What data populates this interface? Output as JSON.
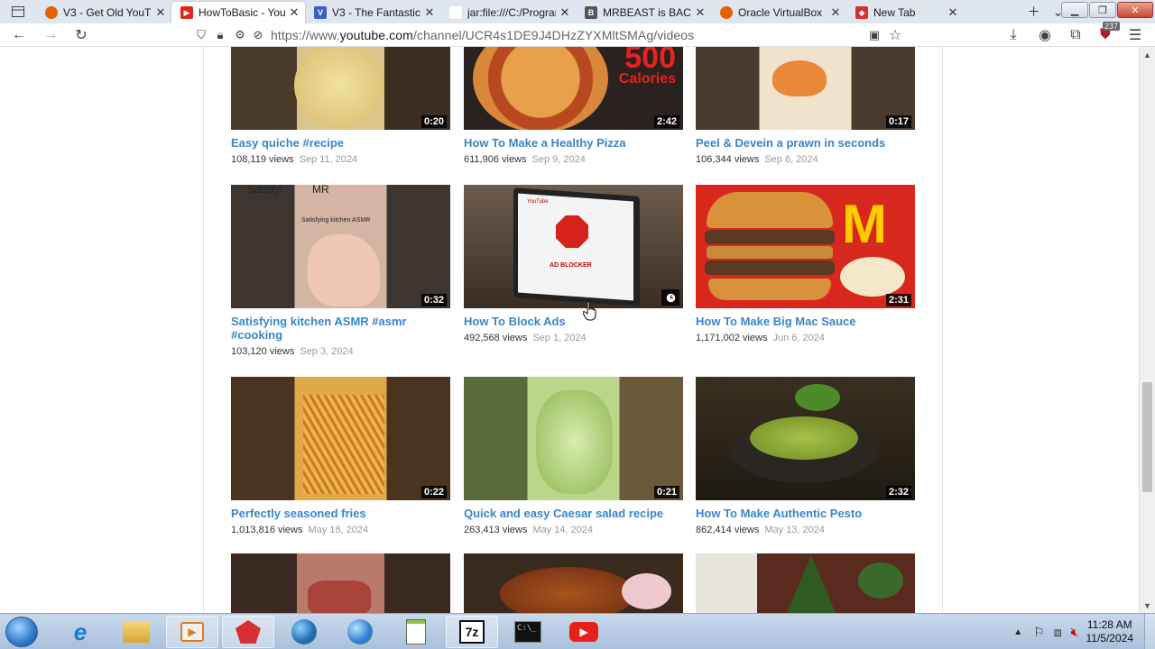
{
  "browser": {
    "tabs": [
      {
        "title": "V3 - Get Old YouT",
        "fav_color": "#e66000",
        "active": false
      },
      {
        "title": "HowToBasic - You",
        "fav_color": "#e62117",
        "active": true
      },
      {
        "title": "V3 - The Fantastic",
        "fav_color": "#3b5fc4",
        "active": false
      },
      {
        "title": "jar:file:///C:/Program",
        "fav_color": "#ffffff",
        "active": false
      },
      {
        "title": "MRBEAST is BACK",
        "fav_color": "#555555",
        "active": false
      },
      {
        "title": "Oracle VirtualBox",
        "fav_color": "#e66000",
        "active": false
      },
      {
        "title": "New Tab",
        "fav_color": "#d63031",
        "active": false
      }
    ],
    "tab_count": "7",
    "url_prefix": "https://www.",
    "url_domain": "youtube.com",
    "url_path": "/channel/UCR4s1DE9J4DHzZYXMltSMAg/videos",
    "ext_badge": "237"
  },
  "videos": [
    {
      "title": "Easy quiche #recipe",
      "views": "108,119 views",
      "date": "Sep 11, 2024",
      "duration": "0:20",
      "thumb": "#b8a47a"
    },
    {
      "title": "How To Make a Healthy Pizza",
      "views": "611,906 views",
      "date": "Sep 9, 2024",
      "duration": "2:42",
      "thumb": "#3a2a22"
    },
    {
      "title": "Peel & Devein a prawn in seconds",
      "views": "106,344 views",
      "date": "Sep 6, 2024",
      "duration": "0:17",
      "thumb": "#e9d2b6"
    },
    {
      "title": "Satisfying kitchen ASMR #asmr #cooking",
      "views": "103,120 views",
      "date": "Sep 3, 2024",
      "duration": "0:32",
      "thumb": "#c9a898"
    },
    {
      "title": "How To Block Ads",
      "views": "492,568 views",
      "date": "Sep 1, 2024",
      "duration": "",
      "thumb": "#6b5a4c"
    },
    {
      "title": "How To Make Big Mac Sauce",
      "views": "1,171,002 views",
      "date": "Jun 6, 2024",
      "duration": "2:31",
      "thumb": "#d8281e"
    },
    {
      "title": "Perfectly seasoned fries",
      "views": "1,013,816 views",
      "date": "May 18, 2024",
      "duration": "0:22",
      "thumb": "#d99b3a"
    },
    {
      "title": "Quick and easy Caesar salad recipe",
      "views": "263,413 views",
      "date": "May 14, 2024",
      "duration": "0:21",
      "thumb": "#9fbf6a"
    },
    {
      "title": "How To Make Authentic Pesto",
      "views": "862,414 views",
      "date": "May 13, 2024",
      "duration": "2:32",
      "thumb": "#5a6b3a"
    },
    {
      "title": "",
      "views": "",
      "date": "",
      "duration": "",
      "thumb": "#8c5a4a"
    },
    {
      "title": "",
      "views": "",
      "date": "",
      "duration": "",
      "thumb": "#7a3a22"
    },
    {
      "title": "",
      "views": "",
      "date": "",
      "duration": "",
      "thumb": "#6a2a22"
    }
  ],
  "thumb_texts": {
    "pizza": "500",
    "pizza_sub": "Calories",
    "asmr": "Satisfying kitchen ASMR",
    "asmr_top": "Satisfyi          MR",
    "adblock": "AD BLOCKER",
    "adblock_brand": "YouTube"
  },
  "taskbar": {
    "time": "11:28 AM",
    "date": "11/5/2024"
  }
}
